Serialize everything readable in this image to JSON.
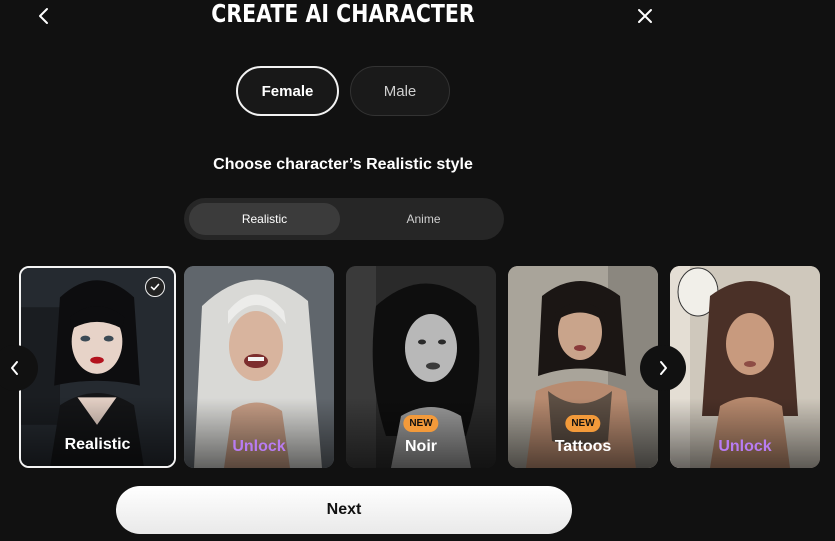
{
  "header": {
    "title": "CREATE AI CHARACTER",
    "back_icon": "chevron-left-icon",
    "close_icon": "close-icon"
  },
  "gender": {
    "options": [
      {
        "label": "Female",
        "selected": true
      },
      {
        "label": "Male",
        "selected": false
      }
    ]
  },
  "style_prompt": "Choose character’s Realistic style",
  "style_toggle": {
    "options": [
      {
        "label": "Realistic",
        "selected": true
      },
      {
        "label": "Anime",
        "selected": false
      }
    ]
  },
  "cards": [
    {
      "label": "Realistic",
      "locked": false,
      "selected": true,
      "badge": ""
    },
    {
      "label": "Unlock",
      "locked": true,
      "selected": false,
      "badge": ""
    },
    {
      "label": "Noir",
      "locked": false,
      "selected": false,
      "badge": "NEW"
    },
    {
      "label": "Tattoos",
      "locked": false,
      "selected": false,
      "badge": "NEW"
    },
    {
      "label": "Unlock",
      "locked": true,
      "selected": false,
      "badge": ""
    }
  ],
  "next_button": {
    "label": "Next"
  },
  "colors": {
    "background": "#111111",
    "unlock_text": "#b87cf2",
    "new_badge": "#f39a3a"
  }
}
